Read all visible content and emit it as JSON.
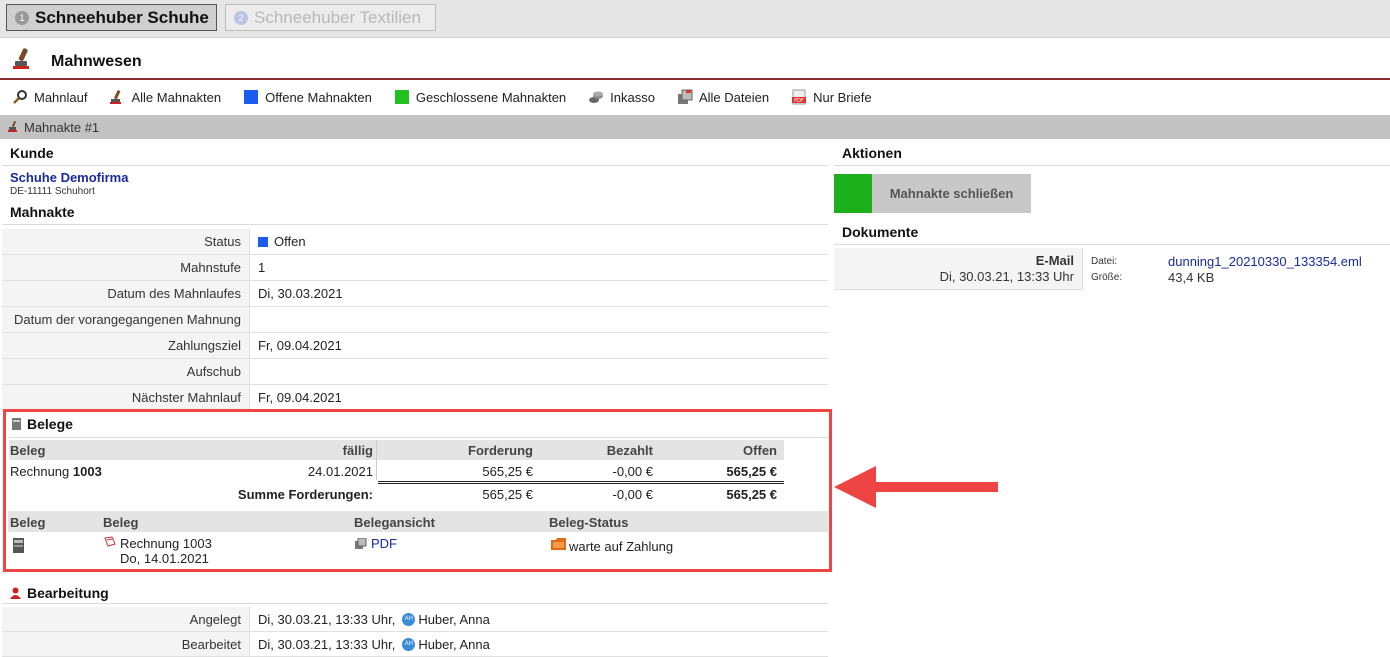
{
  "tabs": [
    {
      "number": "1",
      "label": "Schneehuber Schuhe"
    },
    {
      "number": "2",
      "label": "Schneehuber Textilien"
    }
  ],
  "module": {
    "title": "Mahnwesen"
  },
  "toolbar": [
    {
      "label": "Mahnlauf",
      "icon": "magnifier-icon"
    },
    {
      "label": "Alle Mahnakten",
      "icon": "stamp-icon"
    },
    {
      "label": "Offene Mahnakten",
      "icon": "blue-square-icon",
      "color": "#1a5cf0"
    },
    {
      "label": "Geschlossene Mahnakten",
      "icon": "green-square-icon",
      "color": "#22c222"
    },
    {
      "label": "Inkasso",
      "icon": "coins-icon"
    },
    {
      "label": "Alle Dateien",
      "icon": "files-icon"
    },
    {
      "label": "Nur Briefe",
      "icon": "pdf-icon"
    }
  ],
  "breadcrumb": "Mahnakte #1",
  "kunde": {
    "heading": "Kunde",
    "name": "Schuhe Demofirma",
    "address": "DE-11111 Schuhort"
  },
  "mahnakte": {
    "heading": "Mahnakte",
    "rows": [
      {
        "label": "Status",
        "value": "Offen"
      },
      {
        "label": "Mahnstufe",
        "value": "1"
      },
      {
        "label": "Datum des Mahnlaufes",
        "value": "Di, 30.03.2021"
      },
      {
        "label": "Datum der vorangegangenen Mahnung",
        "value": ""
      },
      {
        "label": "Zahlungsziel",
        "value": "Fr, 09.04.2021"
      },
      {
        "label": "Aufschub",
        "value": ""
      },
      {
        "label": "Nächster Mahnlauf",
        "value": "Fr, 09.04.2021"
      }
    ],
    "status_color": "#1a5cf0"
  },
  "belege": {
    "heading": "Belege",
    "columns": [
      "Beleg",
      "fällig",
      "Forderung",
      "Bezahlt",
      "Offen"
    ],
    "row": {
      "beleg_prefix": "Rechnung",
      "beleg_number": "1003",
      "faellig": "24.01.2021",
      "forderung": "565,25 €",
      "bezahlt": "-0,00 €",
      "offen": "565,25 €"
    },
    "summe": {
      "label": "Summe Forderungen:",
      "forderung": "565,25 €",
      "bezahlt": "-0,00 €",
      "offen": "565,25 €"
    },
    "columns2": [
      "Beleg",
      "Beleg",
      "Belegansicht",
      "Beleg-Status"
    ],
    "row2": {
      "beleg": "Rechnung 1003",
      "date": "Do, 14.01.2021",
      "ansicht": "PDF",
      "status": "warte auf Zahlung"
    }
  },
  "bearbeitung": {
    "heading": "Bearbeitung",
    "rows": [
      {
        "label": "Angelegt",
        "value": "Di, 30.03.21, 13:33 Uhr,",
        "initials": "AH",
        "user": "Huber, Anna"
      },
      {
        "label": "Bearbeitet",
        "value": "Di, 30.03.21, 13:33 Uhr,",
        "initials": "AH",
        "user": "Huber, Anna"
      }
    ]
  },
  "aktionen": {
    "heading": "Aktionen",
    "button": "Mahnakte schließen",
    "color": "#1db01d"
  },
  "dokumente": {
    "heading": "Dokumente",
    "type": "E-Mail",
    "date": "Di, 30.03.21, 13:33 Uhr",
    "file_label": "Datei:",
    "file_name": "dunning1_20210330_133354.eml",
    "size_label": "Größe:",
    "size": "43,4 KB"
  }
}
